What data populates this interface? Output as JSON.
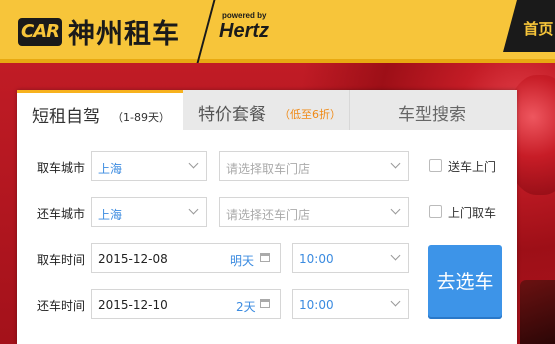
{
  "header": {
    "logo_mark": "CAR",
    "brand": "神州租车",
    "powered_by": "powered by",
    "partner": "Hertz",
    "nav_home": "首页"
  },
  "tabs": [
    {
      "title": "短租自驾",
      "sub": "（1-89天）"
    },
    {
      "title": "特价套餐",
      "sub": "（低至6折）"
    },
    {
      "title": "车型搜索"
    }
  ],
  "form": {
    "pickup_city": {
      "label": "取车城市",
      "value": "上海"
    },
    "pickup_store": {
      "placeholder": "请选择取车门店"
    },
    "deliver_option": {
      "label": "送车上门"
    },
    "return_city": {
      "label": "还车城市",
      "value": "上海"
    },
    "return_store": {
      "placeholder": "请选择还车门店"
    },
    "collect_option": {
      "label": "上门取车"
    },
    "pickup_time": {
      "label": "取车时间",
      "date": "2015-12-08",
      "hint": "明天",
      "time": "10:00"
    },
    "return_time": {
      "label": "还车时间",
      "date": "2015-12-10",
      "hint": "2天",
      "time": "10:00"
    },
    "submit": "去选车"
  },
  "colors": {
    "header_yellow": "#f7c53a",
    "accent_blue": "#3d94e8",
    "tab_orange": "#f08a16"
  }
}
